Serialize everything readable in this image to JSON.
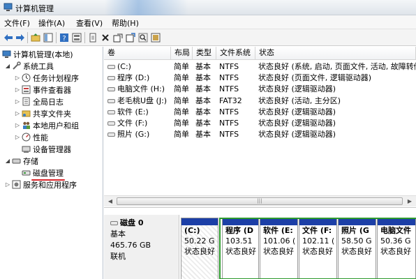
{
  "window": {
    "title": "计算机管理"
  },
  "menu": [
    "文件(F)",
    "操作(A)",
    "查看(V)",
    "帮助(H)"
  ],
  "toolbar": {
    "icons": [
      "back-arrow-icon",
      "forward-arrow-icon",
      "up-folder-icon",
      "show-hide-tree-icon",
      "help-icon",
      "properties-icon",
      "refresh-icon",
      "delete-icon",
      "open-icon",
      "search-icon",
      "settings-icon"
    ]
  },
  "tree": {
    "root": "计算机管理(本地)",
    "system_tools": "系统工具",
    "task_scheduler": "任务计划程序",
    "event_viewer": "事件查看器",
    "global_log": "全局日志",
    "shared_folders": "共享文件夹",
    "local_users": "本地用户和组",
    "performance": "性能",
    "device_manager": "设备管理器",
    "storage": "存储",
    "disk_management": "磁盘管理",
    "services": "服务和应用程序"
  },
  "volumes": {
    "columns": [
      "卷",
      "布局",
      "类型",
      "文件系统",
      "状态"
    ],
    "rows": [
      [
        "(C:)",
        "简单",
        "基本",
        "NTFS",
        "状态良好 (系统, 启动, 页面文件, 活动, 故障转储, 主分"
      ],
      [
        "程序 (D:)",
        "简单",
        "基本",
        "NTFS",
        "状态良好 (页面文件, 逻辑驱动器)"
      ],
      [
        "电脑文件 (H:)",
        "简单",
        "基本",
        "NTFS",
        "状态良好 (逻辑驱动器)"
      ],
      [
        "老毛桃U盘 (J:)",
        "简单",
        "基本",
        "FAT32",
        "状态良好 (活动, 主分区)"
      ],
      [
        "软件 (E:)",
        "简单",
        "基本",
        "NTFS",
        "状态良好 (逻辑驱动器)"
      ],
      [
        "文件 (F:)",
        "简单",
        "基本",
        "NTFS",
        "状态良好 (逻辑驱动器)"
      ],
      [
        "照片 (G:)",
        "简单",
        "基本",
        "NTFS",
        "状态良好 (逻辑驱动器)"
      ]
    ]
  },
  "disk0": {
    "name": "磁盘 0",
    "type": "基本",
    "size": "465.76 GB",
    "status": "联机",
    "partitions": [
      {
        "label": "(C:)",
        "size": "50.22 G",
        "status": "状态良好"
      },
      {
        "label": "程序 (D",
        "size": "103.51",
        "status": "状态良好"
      },
      {
        "label": "软件 (E:",
        "size": "101.06 (",
        "status": "状态良好"
      },
      {
        "label": "文件 (F:",
        "size": "102.11 (",
        "status": "状态良好"
      },
      {
        "label": "照片 (G",
        "size": "58.50 G",
        "status": "状态良好"
      },
      {
        "label": "电脑文件",
        "size": "50.36 G",
        "status": "状态良好"
      }
    ]
  },
  "colors": {
    "partition_bar": "#1c3fa7",
    "extended_frame": "#2c9a2c",
    "highlight": "#d9252b"
  }
}
